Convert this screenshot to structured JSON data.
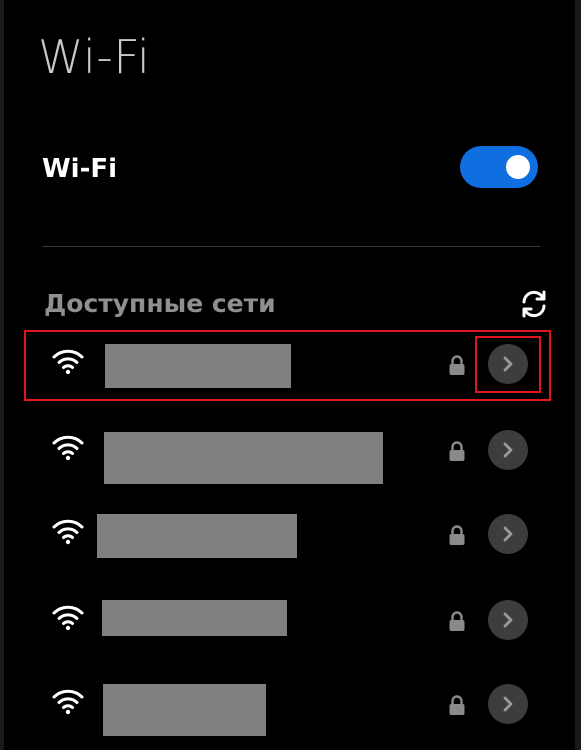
{
  "header": {
    "title": "Wi-Fi"
  },
  "wifi_toggle": {
    "label": "Wi-Fi",
    "state": "on",
    "accent_color": "#0f6fe0"
  },
  "section": {
    "title": "Доступные сети",
    "refresh_icon": "refresh-icon"
  },
  "networks": [
    {
      "name": "",
      "secured": true,
      "signal_icon": "wifi-signal-icon",
      "details_icon": "chevron-right-icon"
    },
    {
      "name": "",
      "secured": true,
      "signal_icon": "wifi-signal-icon",
      "details_icon": "chevron-right-icon"
    },
    {
      "name": "",
      "secured": true,
      "signal_icon": "wifi-signal-icon",
      "details_icon": "chevron-right-icon"
    },
    {
      "name": "",
      "secured": true,
      "signal_icon": "wifi-signal-icon",
      "details_icon": "chevron-right-icon"
    },
    {
      "name": "",
      "secured": true,
      "signal_icon": "wifi-signal-icon",
      "details_icon": "chevron-right-icon"
    }
  ],
  "highlight_color": "#e0161c"
}
